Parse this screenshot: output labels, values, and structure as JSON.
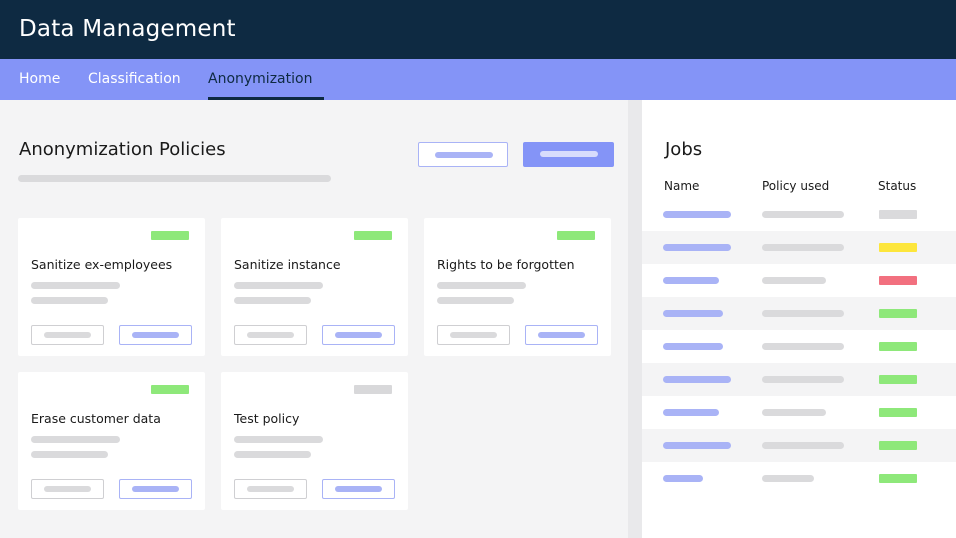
{
  "app": {
    "title": "Data Management"
  },
  "nav": {
    "tabs": [
      {
        "label": "Home",
        "active": false
      },
      {
        "label": "Classification",
        "active": false
      },
      {
        "label": "Anonymization",
        "active": true
      }
    ]
  },
  "policies": {
    "title": "Anonymization Policies",
    "cards": [
      {
        "name": "Sanitize ex-employees",
        "tag_color": "#8ee87a"
      },
      {
        "name": "Sanitize instance",
        "tag_color": "#8ee87a"
      },
      {
        "name": "Rights to be forgotten",
        "tag_color": "#8ee87a"
      },
      {
        "name": "Erase customer data",
        "tag_color": "#8ee87a"
      },
      {
        "name": "Test policy",
        "tag_color": "#d8d8da"
      }
    ]
  },
  "jobs": {
    "title": "Jobs",
    "columns": [
      "Name",
      "Policy used",
      "Status"
    ],
    "rows": [
      {
        "status_color": "#dadadc"
      },
      {
        "status_color": "#fde63c"
      },
      {
        "status_color": "#f2707f"
      },
      {
        "status_color": "#8ee87a"
      },
      {
        "status_color": "#8ee87a"
      },
      {
        "status_color": "#8ee87a"
      },
      {
        "status_color": "#8ee87a"
      },
      {
        "status_color": "#8ee87a"
      },
      {
        "status_color": "#8ee87a"
      }
    ]
  },
  "colors": {
    "header_bg": "#0e2a42",
    "nav_bg": "#8494f7",
    "placeholder_blue": "#a9b3f6",
    "placeholder_gray": "#dadadc"
  }
}
